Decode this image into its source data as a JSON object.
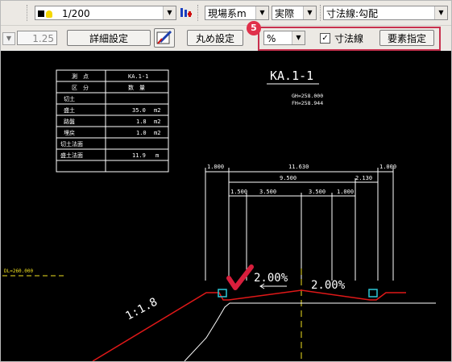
{
  "toolbar1": {
    "layer_value": "1/200",
    "dimension_system": "現場系m",
    "scale_mode": "実際",
    "dimension_line_style": "寸法線:勾配"
  },
  "toolbar2": {
    "size_value": "1.25",
    "detail_settings_label": "詳細設定",
    "rounding_settings_label": "丸め設定",
    "callout_number": "5",
    "unit_value": "%",
    "dimension_line_checkbox_label": "寸法線",
    "dimension_line_checked": true,
    "element_specify_label": "要素指定",
    "callout_color": "#e0304a"
  },
  "drawing": {
    "section_title": "KA.1-1",
    "gh": "GH=258.000",
    "fh": "FH=258.944",
    "dl_label": "DL=260.000",
    "slope_left_label": "1:1.8",
    "grade_left": "2.00%",
    "grade_right": "2.00%",
    "table": {
      "header": [
        "測　点",
        "KA.1-1"
      ],
      "subheader": [
        "区　分",
        "数　量"
      ],
      "rows": [
        [
          "切土",
          ""
        ],
        [
          "盛土",
          "35.0",
          "m2"
        ],
        [
          "路盤",
          "1.8",
          "m2"
        ],
        [
          "埋戻",
          "1.0",
          "m2"
        ],
        [
          "切土法面",
          ""
        ],
        [
          "盛土法面",
          "11.9",
          "m"
        ]
      ]
    },
    "dims_top": [
      "1.000",
      "11.630",
      "1.000"
    ],
    "dims_mid": [
      "9.500",
      "2.130"
    ],
    "dims_low": [
      "1.500",
      "3.500",
      "3.500",
      "1.000"
    ],
    "colors": {
      "road_line": "#e01818",
      "ground_line": "#ffffff",
      "center_line": "#f0e020",
      "dl_line": "#f0e020",
      "check_mark": "#d81e3c",
      "dim_text": "#ffffff"
    }
  }
}
